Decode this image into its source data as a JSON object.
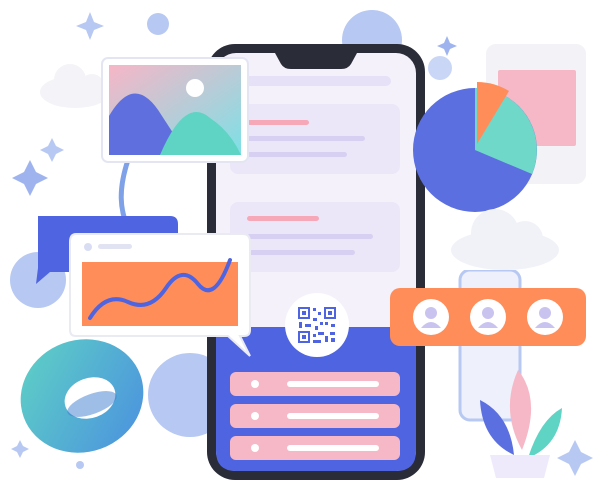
{
  "illustration": {
    "palette": {
      "phone_body": "#2a2c38",
      "phone_screen_top": "#f4f1fb",
      "phone_screen_bottom": "#4f64e0",
      "lavender": "#c9c3f0",
      "indigo": "#5c6fe0",
      "teal": "#5fd3c4",
      "orange": "#ff8d5a",
      "pink": "#f6b8c6",
      "light_blue": "#b7c8f2",
      "white": "#ffffff"
    },
    "elements": [
      {
        "name": "phone",
        "icon": "smartphone-icon"
      },
      {
        "name": "qr-code",
        "icon": "qr-code-icon"
      },
      {
        "name": "image-card",
        "icon": "landscape-image-icon"
      },
      {
        "name": "line-chart-card",
        "icon": "line-chart-icon"
      },
      {
        "name": "pie-chart",
        "icon": "pie-chart-icon"
      },
      {
        "name": "user-avatars",
        "icon": "user-icon",
        "count": 3
      },
      {
        "name": "clouds",
        "icon": "cloud-icon"
      },
      {
        "name": "torus",
        "icon": "ring-icon"
      },
      {
        "name": "plant",
        "icon": "plant-icon"
      },
      {
        "name": "sparkles",
        "icon": "sparkle-icon"
      }
    ]
  }
}
